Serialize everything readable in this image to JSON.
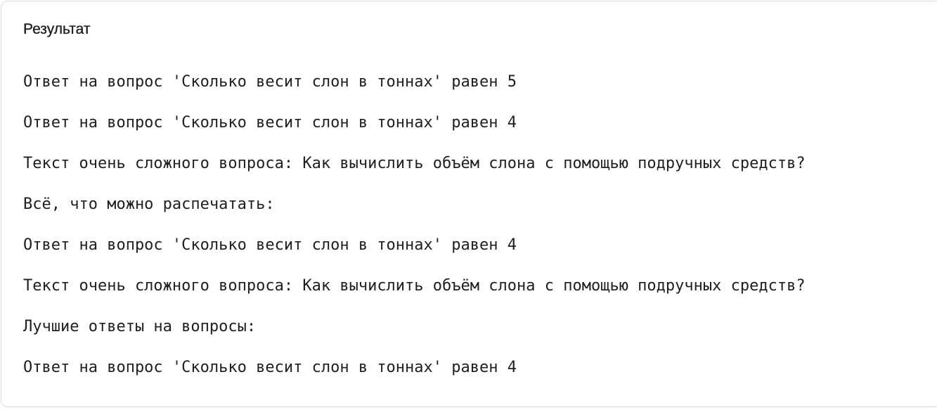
{
  "result": {
    "title": "Результат",
    "lines": [
      "Ответ на вопрос 'Сколько весит слон в тоннах' равен 5",
      "Ответ на вопрос 'Сколько весит слон в тоннах' равен 4",
      "Текст очень сложного вопроса: Как вычислить объём слона с помощью подручных средств?",
      "Всё, что можно распечатать:",
      "Ответ на вопрос 'Сколько весит слон в тоннах' равен 4",
      "Текст очень сложного вопроса: Как вычислить объём слона с помощью подручных средств?",
      "Лучшие ответы на вопросы:",
      "Ответ на вопрос 'Сколько весит слон в тоннах' равен 4"
    ]
  }
}
